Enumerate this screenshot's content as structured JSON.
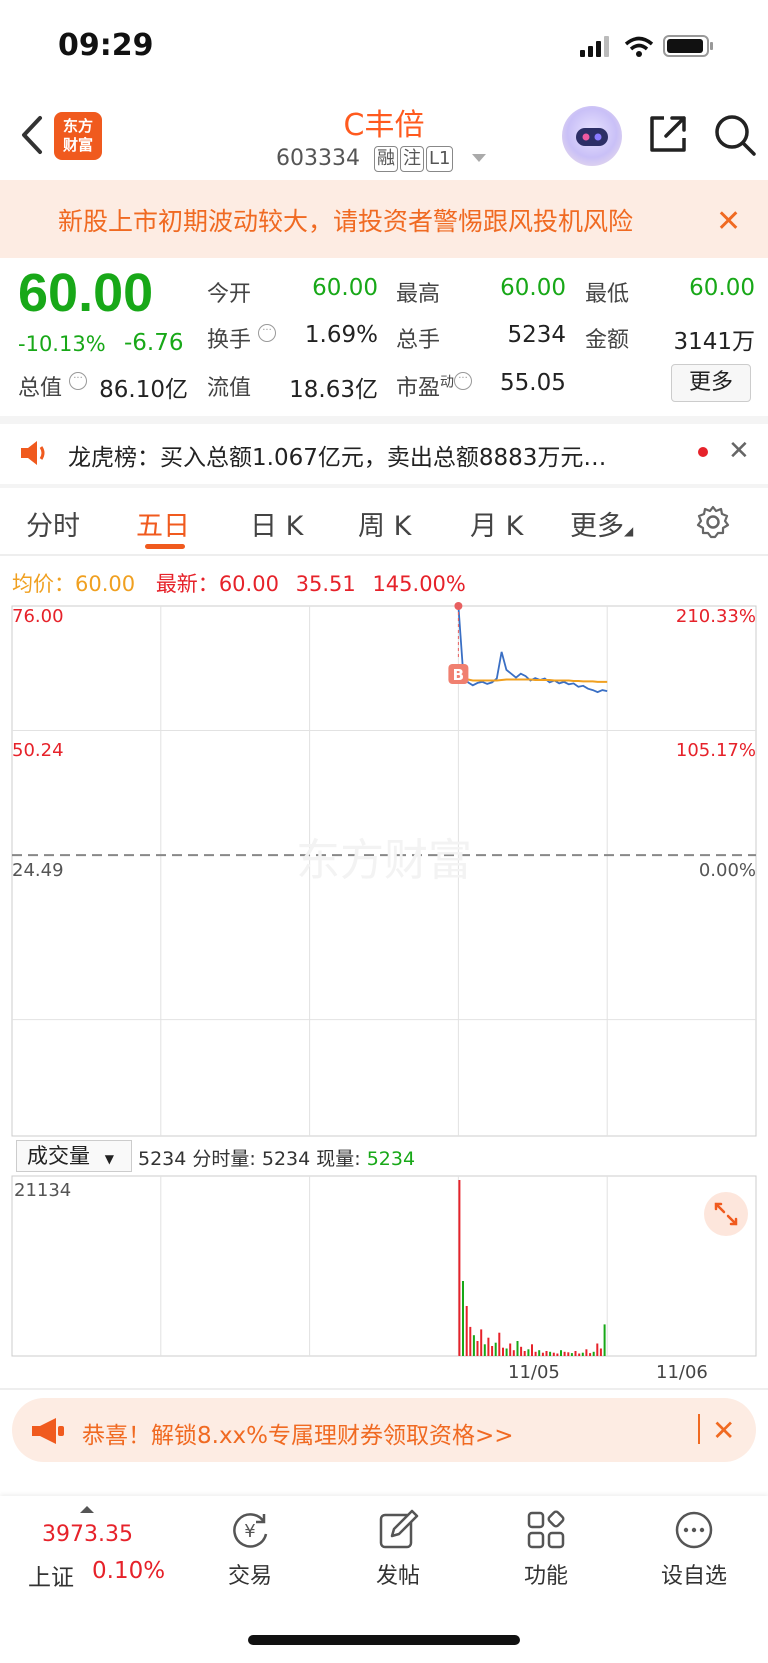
{
  "status_bar": {
    "time": "09:29"
  },
  "header": {
    "logo_line1": "东方",
    "logo_line2": "财富",
    "stock_name": "C丰倍",
    "stock_code": "603334",
    "tags": [
      "融",
      "注",
      "L1"
    ]
  },
  "warning": {
    "text": "新股上市初期波动较大，请投资者警惕跟风投机风险",
    "close": "✕"
  },
  "quote": {
    "price": "60.00",
    "change_pct": "-10.13%",
    "change": "-6.76",
    "open_label": "今开",
    "open": "60.00",
    "high_label": "最高",
    "high": "60.00",
    "low_label": "最低",
    "low": "60.00",
    "turnover_label": "换手",
    "turnover": "1.69%",
    "volume_label": "总手",
    "volume": "5234",
    "amount_label": "金额",
    "amount": "3141万",
    "mktcap_label": "总值",
    "mktcap": "86.10亿",
    "float_label": "流值",
    "float_cap": "18.63亿",
    "pe_label": "市盈",
    "pe_sup": "动",
    "pe": "55.05",
    "more": "更多"
  },
  "dragon_tiger": {
    "text": "龙虎榜：买入总额1.067亿元，卖出总额8883万元…",
    "close": "✕"
  },
  "tabs": [
    "分时",
    "五日",
    "日 K",
    "周 K",
    "月 K",
    "更多"
  ],
  "active_tab": "五日",
  "legend": {
    "avg_label": "均价：",
    "avg_value": "60.00",
    "latest_label": "最新：",
    "latest_value": "60.00",
    "chg_value": "35.51",
    "chg_pct": "145.00%"
  },
  "chart_data": {
    "type": "line",
    "title": "",
    "y_ticks_left": [
      "76.00",
      "50.24",
      "24.49"
    ],
    "y_ticks_right": [
      "210.33%",
      "105.17%",
      "0.00%"
    ],
    "ylim": [
      24.49,
      76.0
    ],
    "prev_close": 24.49,
    "x_dates": [
      "11/05",
      "11/06"
    ],
    "days": 5,
    "active_day_index": 3,
    "marker": "B",
    "series": [
      {
        "values": [
          76.0,
          62.1,
          60.2,
          59.6,
          60.1,
          60.3,
          59.9,
          60.2,
          61.0,
          66.5,
          62.8,
          62.0,
          61.2,
          62.0,
          61.5,
          60.6,
          61.1,
          60.7,
          61.0,
          60.2,
          60.6,
          60.0,
          60.3,
          59.8,
          60.0,
          59.3,
          59.5,
          58.9,
          58.6,
          58.2,
          58.6,
          58.4
        ]
      },
      {
        "values": [
          61.0,
          60.9,
          60.8,
          60.6,
          60.6,
          60.6,
          60.6,
          60.6,
          60.6,
          60.7,
          60.8,
          60.8,
          60.8,
          60.8,
          60.8,
          60.8,
          60.7,
          60.7,
          60.7,
          60.7,
          60.6,
          60.6,
          60.6,
          60.6,
          60.5,
          60.5,
          60.4,
          60.4,
          60.4,
          60.3,
          60.3,
          60.3
        ]
      }
    ]
  },
  "volume": {
    "selector": "成交量",
    "legend_total": "5234",
    "legend_fenshi_label": "分时量:",
    "legend_fenshi": "5234",
    "legend_now_label": "现量:",
    "legend_now": "5234",
    "y_max_label": "21134",
    "bars": [
      21134,
      9000,
      6000,
      3500,
      2500,
      1800,
      3200,
      1400,
      2200,
      1200,
      1600,
      2800,
      1000,
      900,
      1500,
      700,
      1800,
      1100,
      600,
      800,
      1400,
      500,
      700,
      400,
      600,
      500,
      400,
      300,
      700,
      500,
      450,
      350,
      600,
      300,
      400,
      800,
      350,
      500,
      1500,
      900,
      3800
    ]
  },
  "promo": {
    "text": "恭喜！解锁8.xx%专属理财券领取资格>>",
    "close": "✕"
  },
  "bottom": {
    "index_value": "3973.35",
    "index_name": "上证",
    "index_pct": "0.10%",
    "items": [
      "交易",
      "发帖",
      "功能",
      "设自选"
    ]
  }
}
